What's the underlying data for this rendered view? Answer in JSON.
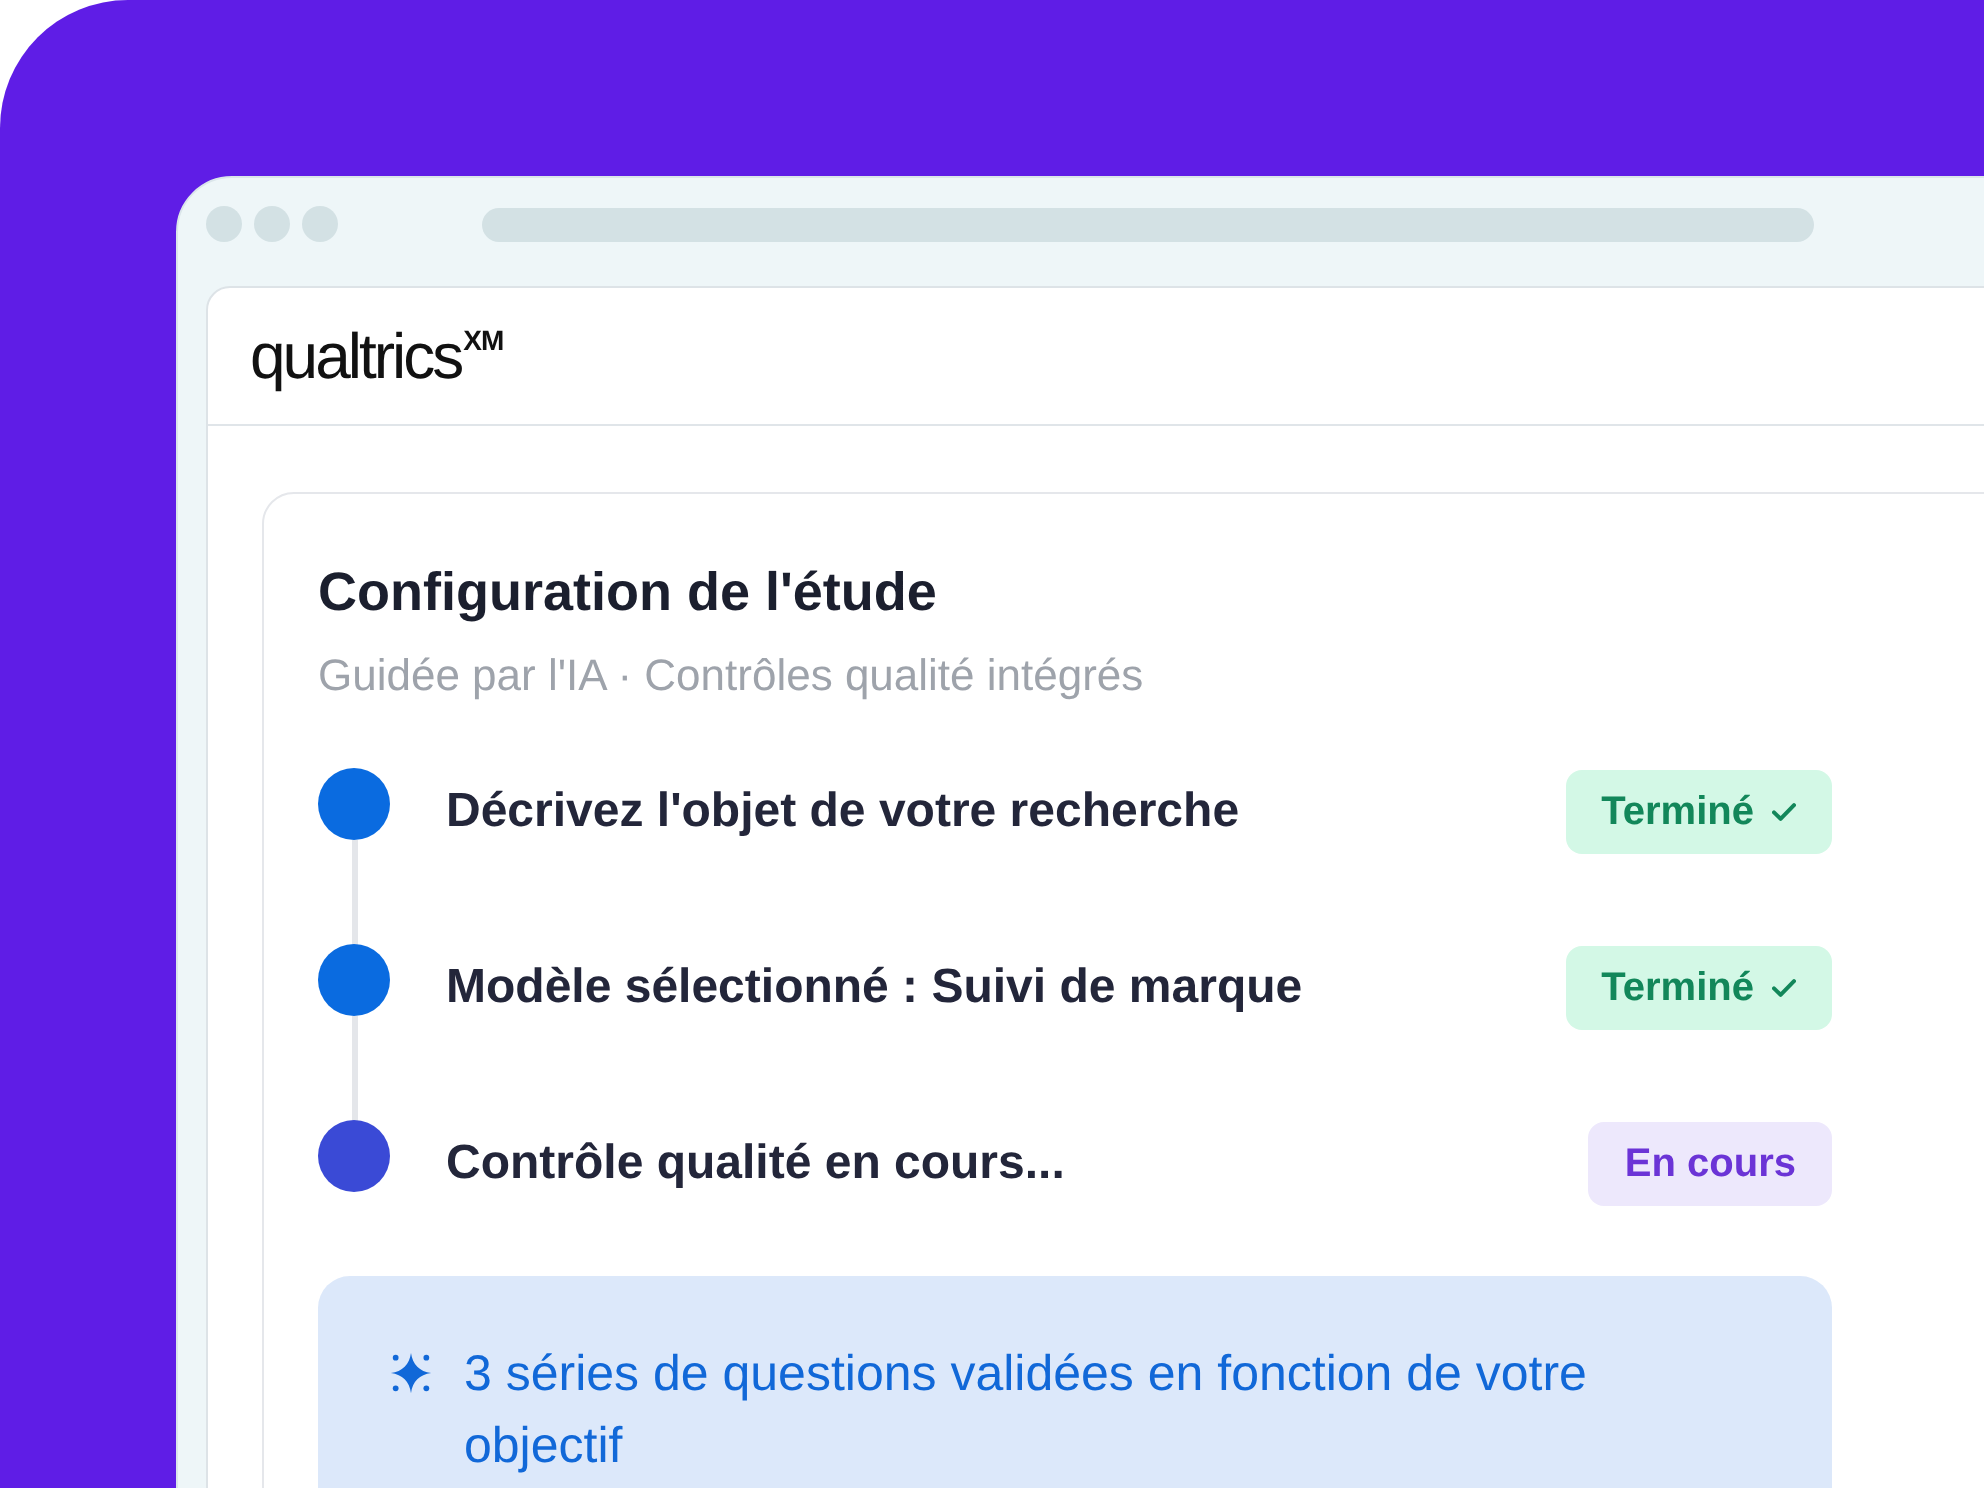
{
  "app_header": {
    "logo": "qualtrics$^{XM}$"
  },
  "card": {
    "title": "Configuration de l'étude",
    "subtitle": "Guidée par l'IA · Contrôles qualité intégrés",
    "steps": [
      {
        "label": "Décrivez l'objet de votre recherche",
        "kind": "done",
        "status_label": "Terminé"
      },
      {
        "label": "Modèle sélectionné : Suivi de marque",
        "kind": "done",
        "status_label": "Terminé"
      },
      {
        "label": "Contrôle qualité en cours...",
        "kind": "in_progress",
        "status_label": "En cours"
      }
    ],
    "insight": {
      "text": "3 séries de questions validées en fonction de votre objectif"
    }
  }
}
